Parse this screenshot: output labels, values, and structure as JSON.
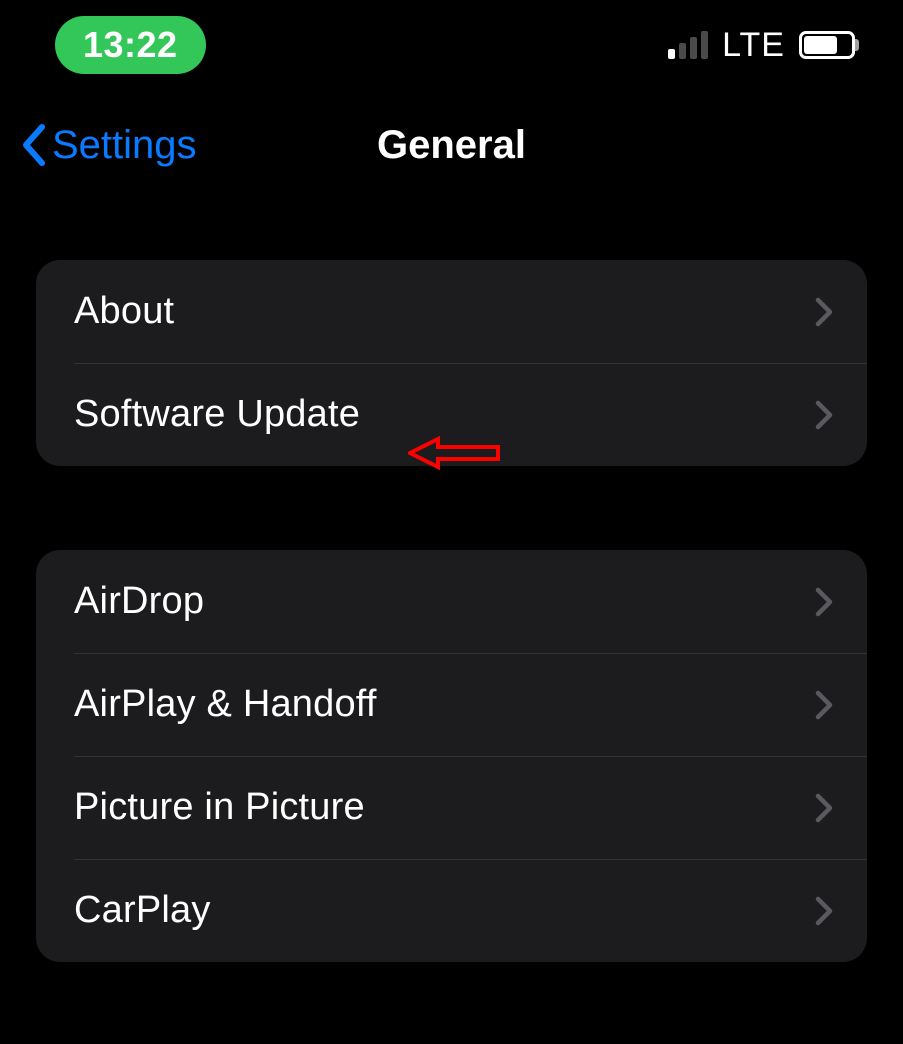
{
  "status_bar": {
    "time": "13:22",
    "network_label": "LTE",
    "battery_fill_pct": 72
  },
  "nav": {
    "back_label": "Settings",
    "title": "General"
  },
  "groups": [
    {
      "rows": [
        {
          "label": "About"
        },
        {
          "label": "Software Update"
        }
      ]
    },
    {
      "rows": [
        {
          "label": "AirDrop"
        },
        {
          "label": "AirPlay & Handoff"
        },
        {
          "label": "Picture in Picture"
        },
        {
          "label": "CarPlay"
        }
      ]
    }
  ],
  "annotation": {
    "color": "#ff0000",
    "points_to": "Software Update"
  }
}
